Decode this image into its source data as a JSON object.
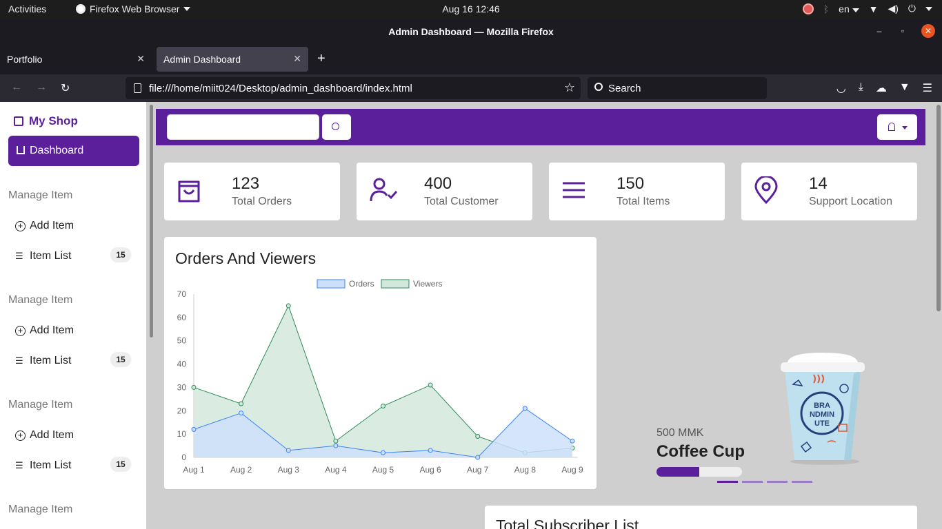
{
  "system": {
    "activities": "Activities",
    "app_name": "Firefox Web Browser",
    "clock": "Aug 16  12:46",
    "lang": "en"
  },
  "browser": {
    "window_title": "Admin Dashboard — Mozilla Firefox",
    "tabs": [
      {
        "label": "Portfolio",
        "active": false
      },
      {
        "label": "Admin Dashboard",
        "active": true
      }
    ],
    "url": "file:///home/miit024/Desktop/admin_dashboard/index.html",
    "search_placeholder": "Search"
  },
  "sidebar": {
    "brand": "My Shop",
    "dashboard_label": "Dashboard",
    "sections": [
      {
        "heading": "Manage Item",
        "add_label": "Add Item",
        "list_label": "Item List",
        "count": "15"
      },
      {
        "heading": "Manage Item",
        "add_label": "Add Item",
        "list_label": "Item List",
        "count": "15"
      },
      {
        "heading": "Manage Item",
        "add_label": "Add Item",
        "list_label": "Item List",
        "count": "15"
      },
      {
        "heading": "Manage Item"
      }
    ]
  },
  "stats": [
    {
      "value": "123",
      "label": "Total Orders",
      "icon": "shopping-bag-icon"
    },
    {
      "value": "400",
      "label": "Total Customer",
      "icon": "user-check-icon"
    },
    {
      "value": "150",
      "label": "Total Items",
      "icon": "menu-lines-icon"
    },
    {
      "value": "14",
      "label": "Support Location",
      "icon": "map-pin-icon"
    }
  ],
  "chart_card_title": "Orders And Viewers",
  "chart_data": {
    "type": "area",
    "categories": [
      "Aug 1",
      "Aug 2",
      "Aug 3",
      "Aug 4",
      "Aug 5",
      "Aug 6",
      "Aug 7",
      "Aug 8",
      "Aug 9"
    ],
    "series": [
      {
        "name": "Orders",
        "values": [
          12,
          19,
          3,
          5,
          2,
          3,
          0,
          21,
          7
        ],
        "color": "#3b82f6",
        "fill": "#cde0fb"
      },
      {
        "name": "Viewers",
        "values": [
          30,
          23,
          65,
          7,
          22,
          31,
          9,
          2,
          4
        ],
        "color": "#2e8b57",
        "fill": "#d3e8dc"
      }
    ],
    "ylim": [
      0,
      70
    ],
    "yticks": [
      0,
      10,
      20,
      30,
      40,
      50,
      60,
      70
    ],
    "legend": "top-center",
    "grid": false
  },
  "promo": {
    "price": "500 MMK",
    "name": "Coffee Cup",
    "cup_text": [
      "BRA",
      "NDMIN",
      "UTE"
    ],
    "progress": 0.5,
    "slides": 4,
    "active_slide": 0
  },
  "subscriber_title": "Total Subscriber List",
  "colors": {
    "primary": "#5b1f9c",
    "page_bg": "#cfcfcf"
  }
}
